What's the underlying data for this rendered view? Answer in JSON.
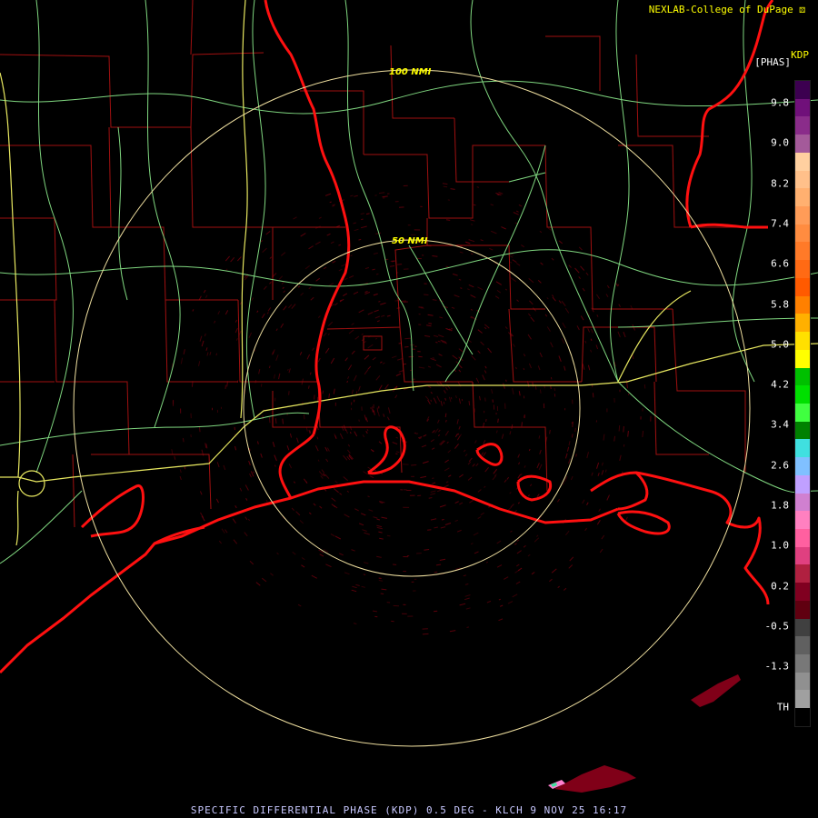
{
  "header": {
    "credit": "NEXLAB-College of DuPage",
    "logo_glyph": "⚄",
    "product_code": "KDP",
    "product_unit": "[PHAS]"
  },
  "rings": [
    {
      "label": "50 NMI"
    },
    {
      "label": "100 NMI"
    }
  ],
  "legend": {
    "labels": [
      "9.8",
      "9.0",
      "8.2",
      "7.4",
      "6.6",
      "5.8",
      "5.0",
      "4.2",
      "3.4",
      "2.6",
      "1.8",
      "1.0",
      "0.2",
      "-0.5",
      "-1.3",
      "TH"
    ],
    "colors": [
      "#3c0050",
      "#70107a",
      "#8a2c8a",
      "#a45a9a",
      "#ffd0a0",
      "#ffc08a",
      "#ffb070",
      "#ff9c58",
      "#ff8c40",
      "#ff7a28",
      "#ff6a14",
      "#ff5a00",
      "#ff8000",
      "#ffb000",
      "#ffe000",
      "#ffff00",
      "#00c000",
      "#00e000",
      "#40ff40",
      "#008000",
      "#40e0e0",
      "#80c0ff",
      "#c0a0ff",
      "#d080d0",
      "#ff80c0",
      "#ff60a0",
      "#e04080",
      "#b02040",
      "#800020",
      "#600010",
      "#404040",
      "#606060",
      "#787878",
      "#909090",
      "#a0a0a0",
      "#000000"
    ]
  },
  "caption": {
    "text": "SPECIFIC DIFFERENTIAL PHASE (KDP) 0.5 DEG - KLCH 9 NOV 25 16:17"
  },
  "colors": {
    "coastline": "#ff1010",
    "county_lines": "#a01010",
    "highways": "#80d880",
    "interstates": "#e8e860",
    "range_rings": "#f0e0a0",
    "echo": "#800010"
  }
}
